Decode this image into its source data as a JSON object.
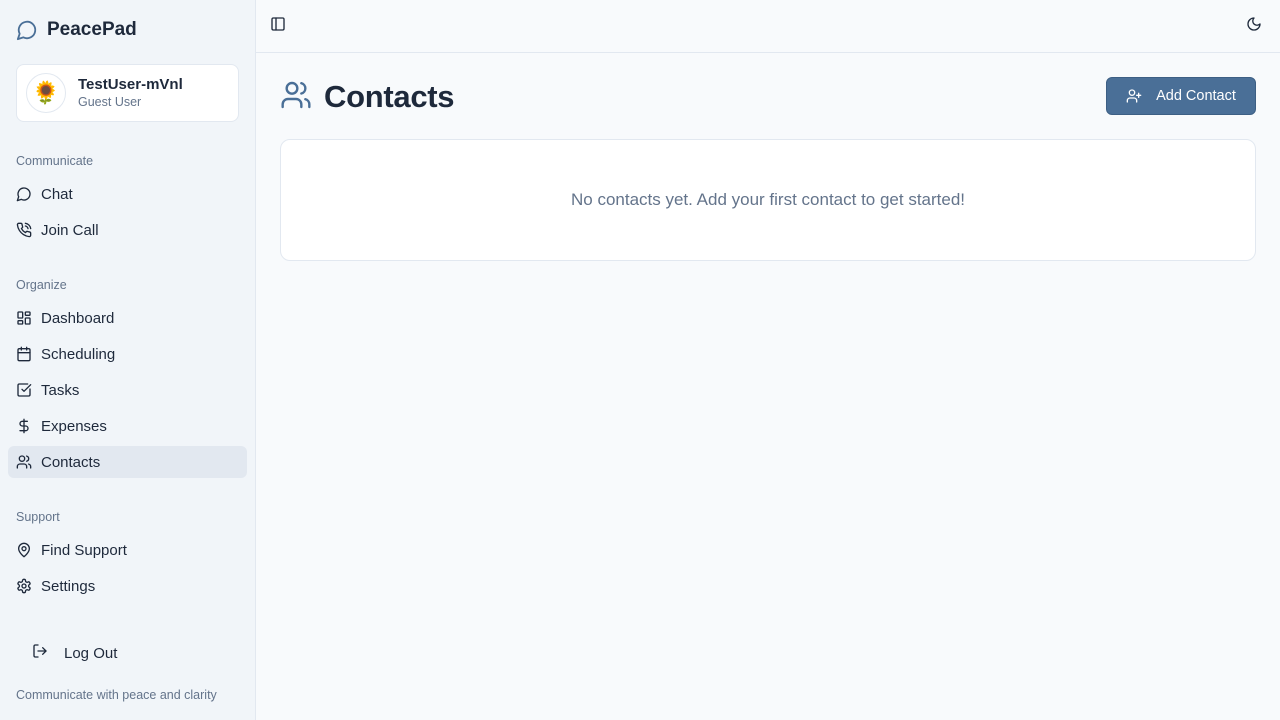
{
  "app": {
    "name": "PeacePad",
    "tagline": "Communicate with peace and clarity"
  },
  "user": {
    "avatar": "🌻",
    "name": "TestUser-mVnl",
    "role": "Guest User"
  },
  "sidebar": {
    "sections": [
      {
        "title": "Communicate",
        "items": [
          {
            "label": "Chat",
            "icon": "message-circle-icon"
          },
          {
            "label": "Join Call",
            "icon": "phone-call-icon"
          }
        ]
      },
      {
        "title": "Organize",
        "items": [
          {
            "label": "Dashboard",
            "icon": "layout-dashboard-icon"
          },
          {
            "label": "Scheduling",
            "icon": "calendar-icon"
          },
          {
            "label": "Tasks",
            "icon": "check-square-icon"
          },
          {
            "label": "Expenses",
            "icon": "dollar-sign-icon"
          },
          {
            "label": "Contacts",
            "icon": "users-icon",
            "active": true
          }
        ]
      },
      {
        "title": "Support",
        "items": [
          {
            "label": "Find Support",
            "icon": "map-pin-icon"
          },
          {
            "label": "Settings",
            "icon": "settings-icon"
          }
        ]
      }
    ],
    "logout_label": "Log Out"
  },
  "main": {
    "title": "Contacts",
    "add_button_label": "Add Contact",
    "empty_message": "No contacts yet. Add your first contact to get started!"
  },
  "colors": {
    "primary": "#4a6f97",
    "sidebar_bg": "#f1f5f9",
    "page_bg": "#f8fafc",
    "active_item_bg": "#e2e8f0",
    "muted_text": "#64748b",
    "text": "#1e293b"
  }
}
